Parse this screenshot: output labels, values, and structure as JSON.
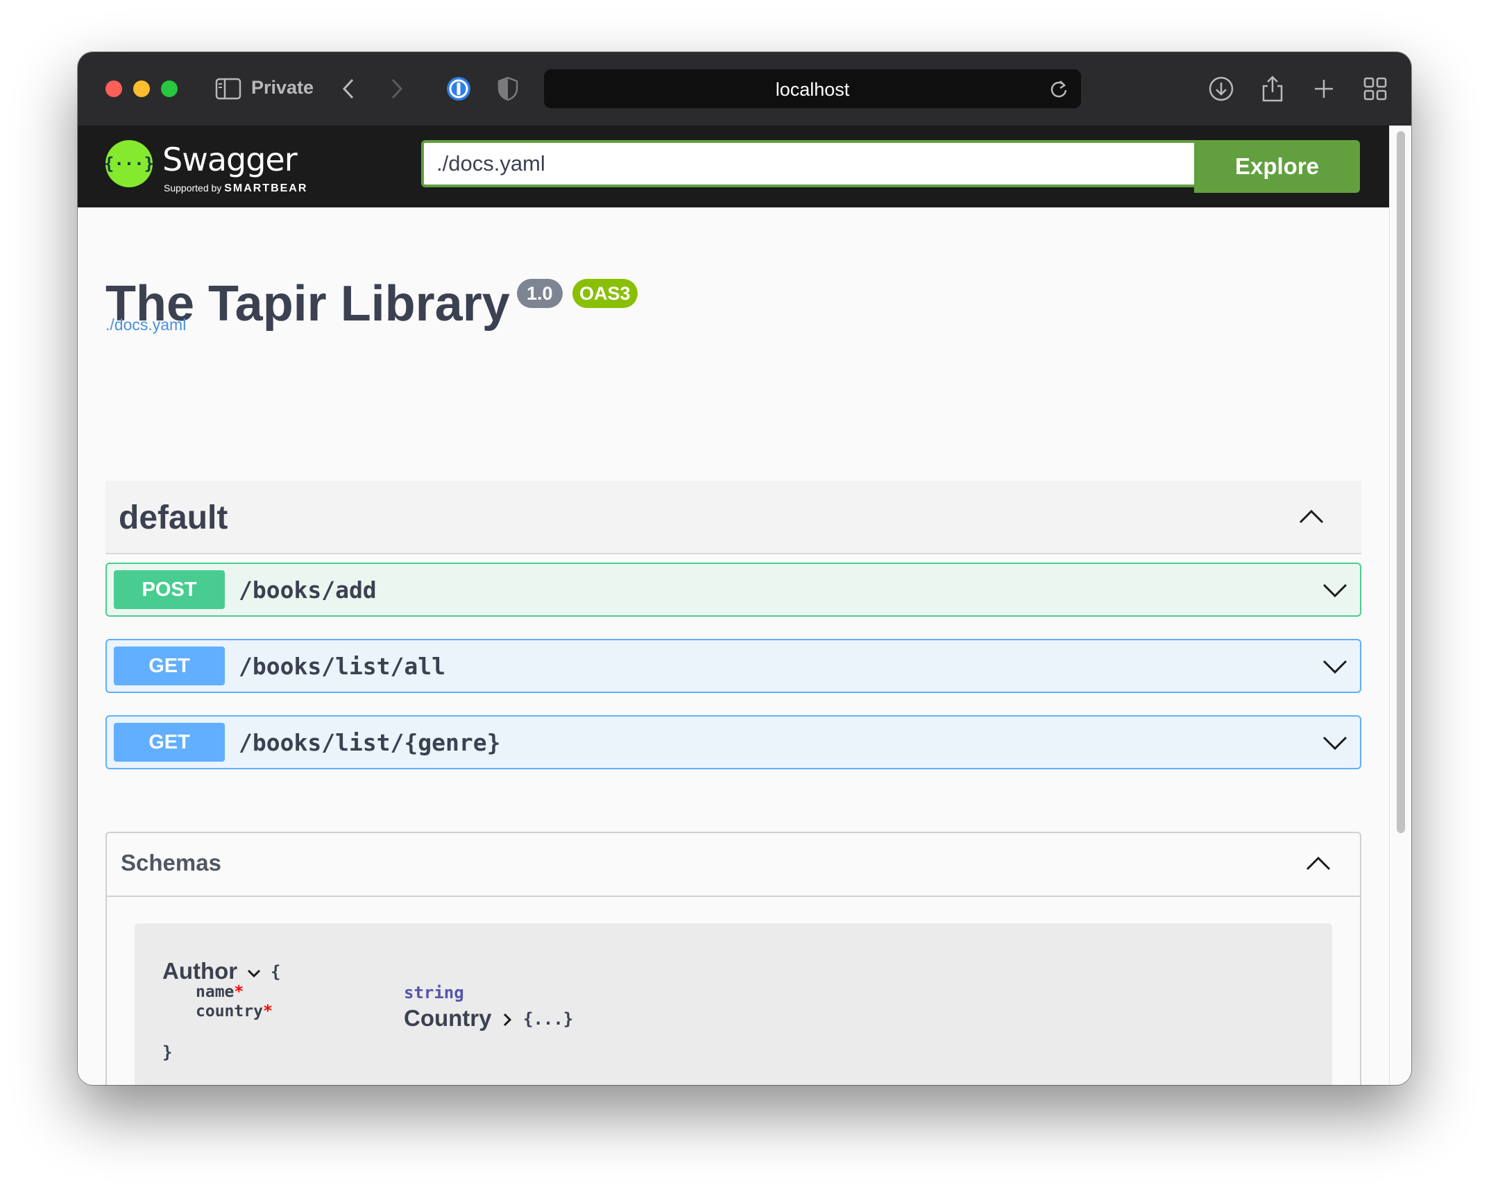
{
  "browser": {
    "mode_label": "Private",
    "url": "localhost",
    "colors": {
      "close": "#fe5f57",
      "minimize": "#febc2e",
      "maximize": "#28c840"
    },
    "icons": [
      "sidebar-icon",
      "back-icon",
      "forward-icon",
      "password-manager-icon",
      "shield-icon",
      "reload-icon",
      "download-icon",
      "share-icon",
      "new-tab-icon",
      "tab-overview-icon"
    ]
  },
  "swagger": {
    "logo_text": "Swagger",
    "logo_glyph": "{···}",
    "supported_by": "Supported by",
    "smartbear": "SMARTBEAR",
    "spec_url_value": "./docs.yaml",
    "explore_label": "Explore",
    "accent": "#62a03f"
  },
  "info": {
    "title": "The Tapir Library",
    "version": "1.0",
    "oas_badge": "OAS3",
    "spec_link": "./docs.yaml"
  },
  "tag": {
    "name": "default"
  },
  "operations": [
    {
      "method": "POST",
      "path": "/books/add",
      "color": "#49cc90"
    },
    {
      "method": "GET",
      "path": "/books/list/all",
      "color": "#61affe"
    },
    {
      "method": "GET",
      "path": "/books/list/{genre}",
      "color": "#61affe"
    }
  ],
  "schemas": {
    "title": "Schemas",
    "models": [
      {
        "name": "Author",
        "open_brace": "{",
        "close_brace": "}",
        "properties": [
          {
            "name": "name",
            "required_mark": "*",
            "type": "string"
          },
          {
            "name": "country",
            "required_mark": "*",
            "ref": "Country",
            "collapsed": "{...}"
          }
        ]
      }
    ]
  }
}
